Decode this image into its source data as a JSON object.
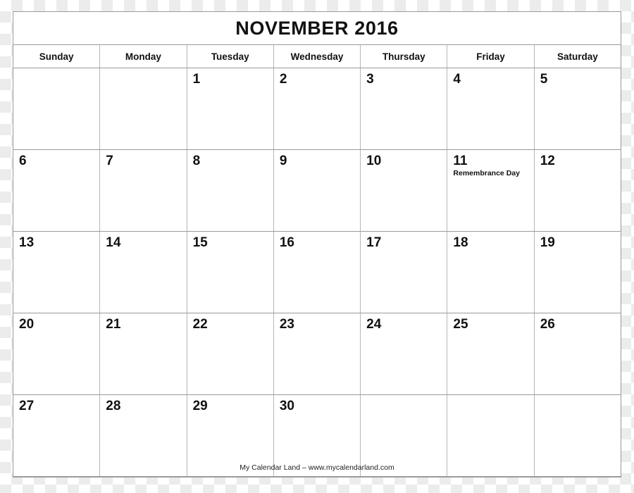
{
  "calendar": {
    "title": "NOVEMBER 2016",
    "month": "November",
    "year": "2016",
    "weekday_headers": [
      {
        "label": "Sunday"
      },
      {
        "label": "Monday"
      },
      {
        "label": "Tuesday"
      },
      {
        "label": "Wednesday"
      },
      {
        "label": "Thursday"
      },
      {
        "label": "Friday"
      },
      {
        "label": "Saturday"
      }
    ],
    "weeks": [
      {
        "days": [
          {
            "number": "",
            "event": ""
          },
          {
            "number": "",
            "event": ""
          },
          {
            "number": "1",
            "event": ""
          },
          {
            "number": "2",
            "event": ""
          },
          {
            "number": "3",
            "event": ""
          },
          {
            "number": "4",
            "event": ""
          },
          {
            "number": "5",
            "event": ""
          }
        ]
      },
      {
        "days": [
          {
            "number": "6",
            "event": ""
          },
          {
            "number": "7",
            "event": ""
          },
          {
            "number": "8",
            "event": ""
          },
          {
            "number": "9",
            "event": ""
          },
          {
            "number": "10",
            "event": ""
          },
          {
            "number": "11",
            "event": "Remembrance Day"
          },
          {
            "number": "12",
            "event": ""
          }
        ]
      },
      {
        "days": [
          {
            "number": "13",
            "event": ""
          },
          {
            "number": "14",
            "event": ""
          },
          {
            "number": "15",
            "event": ""
          },
          {
            "number": "16",
            "event": ""
          },
          {
            "number": "17",
            "event": ""
          },
          {
            "number": "18",
            "event": ""
          },
          {
            "number": "19",
            "event": ""
          }
        ]
      },
      {
        "days": [
          {
            "number": "20",
            "event": ""
          },
          {
            "number": "21",
            "event": ""
          },
          {
            "number": "22",
            "event": ""
          },
          {
            "number": "23",
            "event": ""
          },
          {
            "number": "24",
            "event": ""
          },
          {
            "number": "25",
            "event": ""
          },
          {
            "number": "26",
            "event": ""
          }
        ]
      },
      {
        "days": [
          {
            "number": "27",
            "event": ""
          },
          {
            "number": "28",
            "event": ""
          },
          {
            "number": "29",
            "event": ""
          },
          {
            "number": "30",
            "event": ""
          },
          {
            "number": "",
            "event": ""
          },
          {
            "number": "",
            "event": ""
          },
          {
            "number": "",
            "event": ""
          }
        ]
      }
    ],
    "footer": {
      "credit": "My Calendar Land – www.mycalendarland.com"
    },
    "colors": {
      "text": "#111111",
      "grid_line_major": "#9a9a9a",
      "grid_line_minor": "#b7b7b7",
      "page_background": "#ffffff",
      "checker_light": "#ffffff",
      "checker_dark": "#ececec"
    }
  }
}
